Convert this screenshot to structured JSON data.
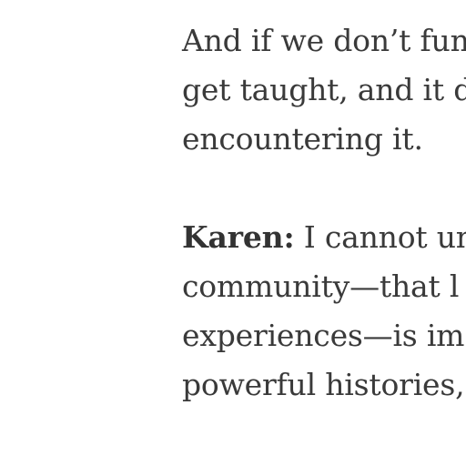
{
  "article": {
    "paragraph_1": {
      "lines": [
        "And if we don’t fun",
        "get taught, and it d",
        "encountering it."
      ]
    },
    "paragraph_2": {
      "speaker": "Karen:",
      "first_line_text": " I cannot unc",
      "lines": [
        "community—that l",
        "experiences—is im",
        "powerful histories,"
      ]
    }
  }
}
